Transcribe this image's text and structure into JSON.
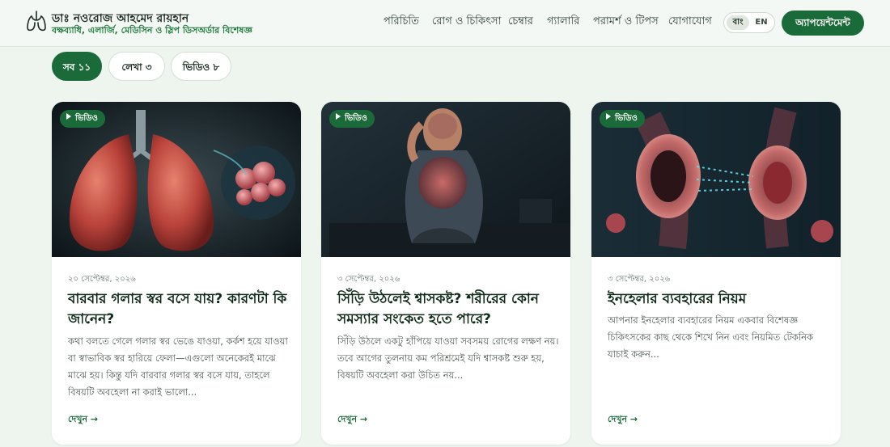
{
  "header": {
    "brand_name": "ডাঃ নওরোজ আহমেদ রায়হান",
    "brand_tagline": "বক্ষব্যাধি, এলার্জি, মেডিসিন ও স্লিপ ডিসঅর্ডার বিশেষজ্ঞ",
    "logo_icon": "lungs-icon",
    "nav": [
      {
        "label": "পরিচিতি"
      },
      {
        "label": "রোগ ও চিকিৎসা"
      },
      {
        "label": "চেম্বার"
      },
      {
        "label": "গ্যালারি"
      },
      {
        "label": "পরামর্শ ও টিপস"
      },
      {
        "label": "যোগাযোগ"
      }
    ],
    "lang": {
      "bn": "বাং",
      "en": "EN",
      "selected": "বাং"
    },
    "cta_label": "অ্যাপয়েন্টমেন্ট"
  },
  "filters": [
    {
      "label": "সব ১১",
      "active": true
    },
    {
      "label": "লেখা ৩",
      "active": false
    },
    {
      "label": "ভিডিও ৮",
      "active": false
    }
  ],
  "cards": [
    {
      "badge": "ভিডিও",
      "date": "২০ সেপ্টেম্বর, ২০২৬",
      "title": "বারবার গলার স্বর বসে যায়? কারণটা কি জানেন?",
      "excerpt": "কথা বলতে গেলে গলার স্বর ভেঙে যাওয়া, কর্কশ হয়ে যাওয়া বা স্বাভাবিক স্বর হারিয়ে ফেলা—এগুলো অনেকেরই মাঝে মাঝে হয়। কিন্তু যদি বারবার গলার স্বর বসে যায়, তাহলে বিষয়টি অবহেলা না করাই ভালো...",
      "link": "দেখুন →",
      "image": "lungs-illustration"
    },
    {
      "badge": "ভিডিও",
      "date": "৩ সেপ্টেম্বর, ২০২৬",
      "title": "সিঁড়ি উঠলেই শ্বাসকষ্ট? শরীরের কোন সমস্যার সংকেত হতে পারে?",
      "excerpt": "সিঁড়ি উঠলে একটু হাঁপিয়ে যাওয়া সবসময় রোগের লক্ষণ নয়। তবে আগের তুলনায় কম পরিশ্রমেই যদি শ্বাসকষ্ট শুরু হয়, বিষয়টি অবহেলা করা উচিত নয়...",
      "link": "দেখুন →",
      "image": "man-breathless-illustration"
    },
    {
      "badge": "ভিডিও",
      "date": "৩ সেপ্টেম্বর, ২০২৬",
      "title": "ইনহেলার ব্যবহারের নিয়ম",
      "excerpt": "আপনার ইনহেলার ব্যবহারের নিয়ম একবার বিশেষজ্ঞ চিকিৎসকের কাছ থেকে শিখে নিন এবং নিয়মিত টেকনিক যাচাই করুন...",
      "link": "দেখুন →",
      "image": "airway-illustration"
    }
  ]
}
